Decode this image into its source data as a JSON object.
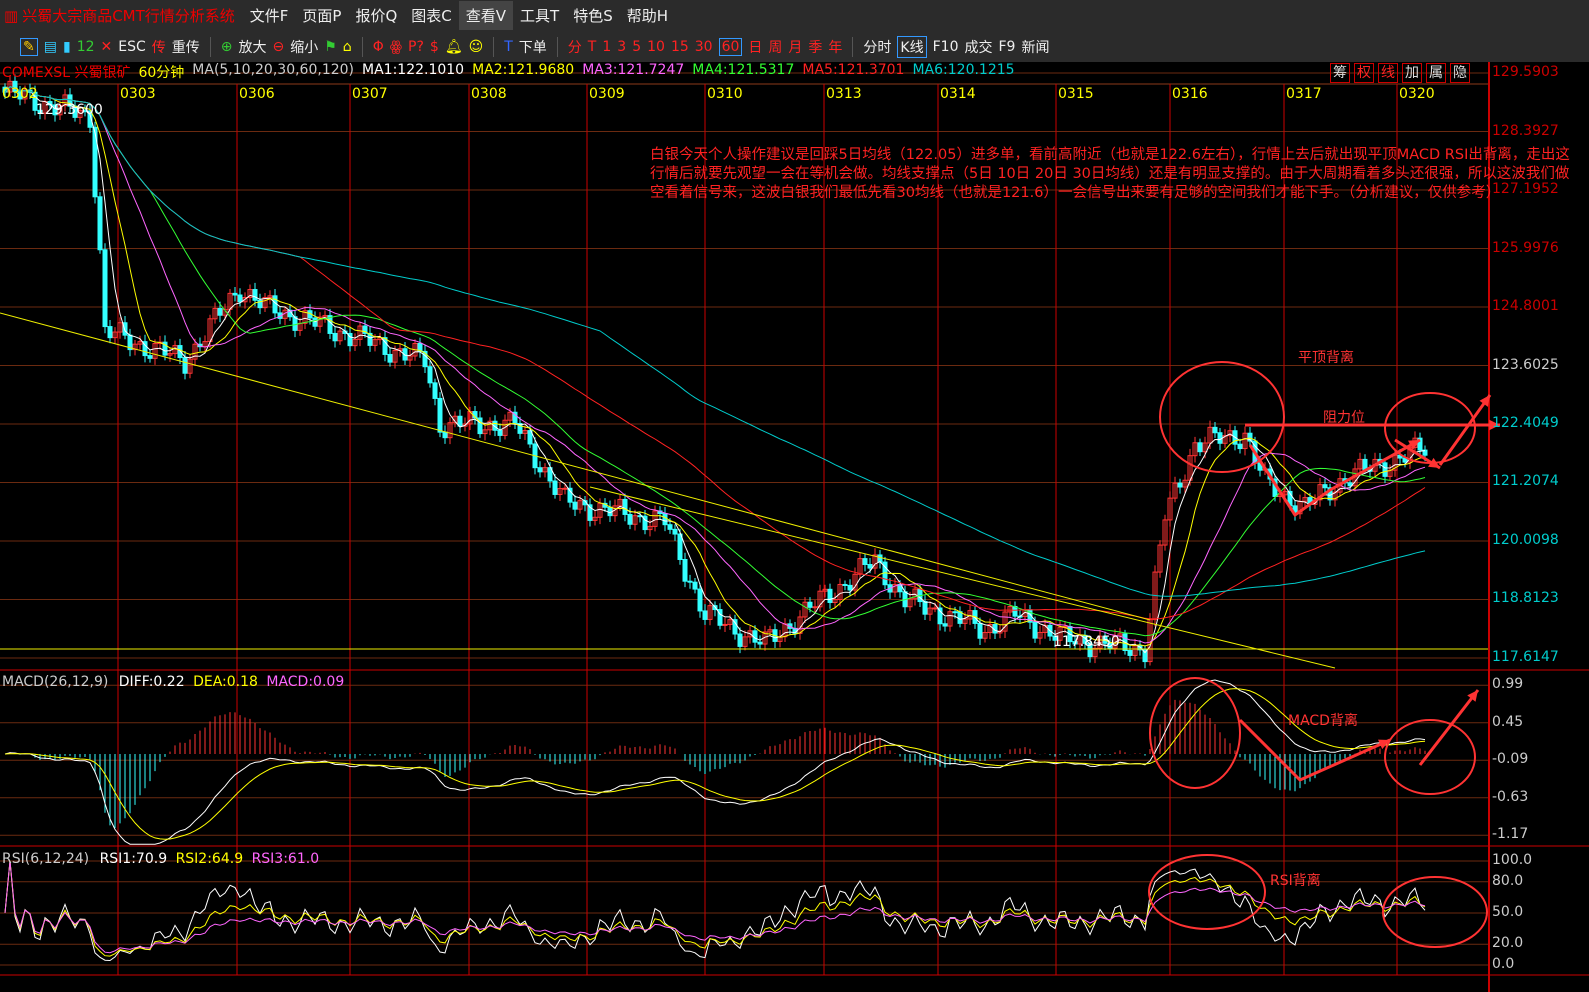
{
  "menubar": {
    "title": "兴蜀大宗商品CMT行情分析系统",
    "items": [
      "文件F",
      "页面P",
      "报价Q",
      "图表C",
      "查看V",
      "工具T",
      "特色S",
      "帮助H"
    ],
    "active": "查看V"
  },
  "toolbar": {
    "items": [
      "12",
      "ESC",
      "传",
      "重传",
      "放大",
      "缩小",
      "下单"
    ],
    "periods": [
      "分",
      "T",
      "1",
      "3",
      "5",
      "10",
      "15",
      "30",
      "60",
      "日",
      "周",
      "月",
      "季",
      "年"
    ],
    "selected_period": "60",
    "views": [
      "分时",
      "K线",
      "F10",
      "成交",
      "F9",
      "新闻"
    ],
    "selected_view": "K线"
  },
  "info": {
    "symbol": "COMEXSL 兴蜀银矿",
    "period": "60分钟",
    "ma_params": "MA(5,10,20,30,60,120)",
    "ma1": "MA1:122.1010",
    "ma2": "MA2:121.9680",
    "ma3": "MA3:121.7247",
    "ma4": "MA4:121.5317",
    "ma5": "MA5:121.3701",
    "ma6": "MA6:120.1215"
  },
  "side_buttons": [
    "筹",
    "权",
    "线",
    "加",
    "属",
    "隐"
  ],
  "colors": {
    "ma1": "#ffffff",
    "ma2": "#ffff00",
    "ma3": "#ff66ff",
    "ma4": "#33ff33",
    "ma5": "#ff2222",
    "ma6": "#00cccc",
    "up": "#ff3333",
    "down": "#33ffff",
    "grid": "#8b1a1a",
    "annot": "#ff3333"
  },
  "note": "白银今天个人操作建议是回踩5日均线（122.05）进多单，看前高附近（也就是122.6左右），行情上去后就出现平顶MACD RSI出背离，走出这行情后就要先观望一会在等机会做。均线支撑点（5日 10日 20日 30日均线）还是有明显支撑的。由于大周期看着多头还很强，所以这波我们做空看着信号来，这波白银我们最低先看30均线（也就是121.6）一会信号出来要有足够的空间我们才能下手。（分析建议，仅供参考）",
  "annotations": {
    "top": "平顶背离",
    "resistance": "阻力位",
    "macd": "MACD背离",
    "rsi": "RSI背离",
    "high_label": "129.3600",
    "low_label": "117.8450"
  },
  "macd_info": {
    "params": "MACD(26,12,9)",
    "diff": "DIFF:0.22",
    "dea": "DEA:0.18",
    "macd": "MACD:0.09"
  },
  "rsi_info": {
    "params": "RSI(6,12,24)",
    "rsi1": "RSI1:70.9",
    "rsi2": "RSI2:64.9",
    "rsi3": "RSI3:61.0"
  },
  "chart_data": {
    "type": "candlestick",
    "dates": [
      "0302",
      "0303",
      "0306",
      "0307",
      "0308",
      "0309",
      "0310",
      "0313",
      "0314",
      "0315",
      "0316",
      "0317",
      "0320"
    ],
    "price_axis": [
      "129.5903",
      "128.3927",
      "127.1952",
      "125.9976",
      "124.8001",
      "123.6025",
      "122.4049",
      "121.2074",
      "120.0098",
      "118.8123",
      "117.6147"
    ],
    "price_range": [
      117.6147,
      129.5903
    ],
    "macd_axis": [
      "0.99",
      "0.45",
      "-0.09",
      "-0.63",
      "-1.17"
    ],
    "rsi_axis": [
      "100.0",
      "80.0",
      "50.0",
      "20.0",
      "0.0"
    ],
    "approx_close_path_by_bar": [
      [
        0,
        129.2
      ],
      [
        17,
        128.7
      ],
      [
        19,
        125.9
      ],
      [
        20,
        124.3
      ],
      [
        36,
        123.7
      ],
      [
        47,
        125.2
      ],
      [
        52,
        124.8
      ],
      [
        64,
        124.4
      ],
      [
        84,
        123.7
      ],
      [
        87,
        122.4
      ],
      [
        102,
        122.4
      ],
      [
        112,
        120.8
      ],
      [
        132,
        120.4
      ],
      [
        140,
        118.5
      ],
      [
        152,
        117.9
      ],
      [
        158,
        118.4
      ],
      [
        174,
        119.6
      ],
      [
        180,
        118.8
      ],
      [
        196,
        118.2
      ],
      [
        202,
        118.5
      ],
      [
        212,
        118.0
      ],
      [
        228,
        117.8
      ],
      [
        232,
        120.5
      ],
      [
        238,
        122.0
      ],
      [
        248,
        122.2
      ],
      [
        252,
        121.2
      ],
      [
        260,
        120.7
      ],
      [
        268,
        121.3
      ],
      [
        284,
        121.9
      ]
    ]
  }
}
